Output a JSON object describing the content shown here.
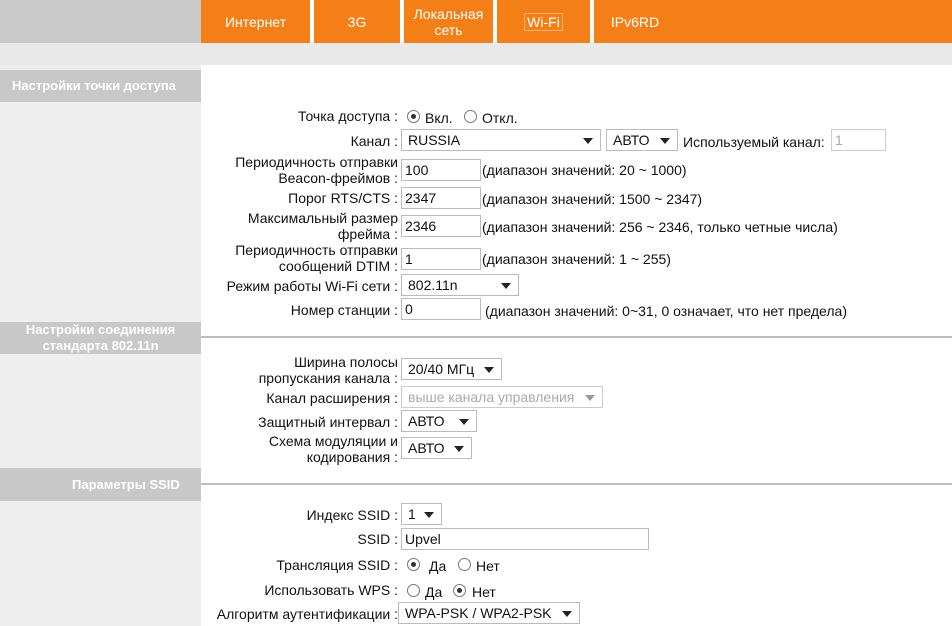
{
  "tabs": [
    "Интернет",
    "3G",
    "Локальная\nсеть",
    "Wi-Fi",
    "IPv6RD"
  ],
  "sections": {
    "ap": "Настройки точки доступа",
    "n": "Настройки соединения стандарта 802.11n",
    "ssid": "Параметры SSID"
  },
  "labels": {
    "ap": "Точка доступа :",
    "channel": "Канал :",
    "beacon": "Периодичность отправки Beacon-фреймов :",
    "rts": "Порог RTS/CTS :",
    "frag": "Максимальный размер фрейма :",
    "dtim": "Периодичность отправки сообщений DTIM :",
    "mode": "Режим работы Wi-Fi сети :",
    "station": "Номер станции :",
    "bw": "Ширина полосы пропускания канала :",
    "ext": "Канал расширения :",
    "guard": "Защитный интервал :",
    "mcs": "Схема модуляции и кодирования :",
    "ssid_idx": "Индекс SSID :",
    "ssid": "SSID :",
    "bcast": "Трансляция SSID :",
    "wps": "Использовать WPS :",
    "auth": "Алгоритм аутентификации :"
  },
  "values": {
    "on": "Вкл.",
    "off": "Откл.",
    "country": "RUSSIA",
    "channel": "АВТО",
    "used_ch_label": "Используемый канал:",
    "used_ch": "1",
    "beacon": "100",
    "beacon_hint": "(диапазон значений: 20 ~ 1000)",
    "rts": "2347",
    "rts_hint": "(диапазон значений: 1500 ~ 2347)",
    "frag": "2346",
    "frag_hint": "(диапазон значений: 256 ~ 2346, только четные числа)",
    "dtim": "1",
    "dtim_hint": "(диапазон значений: 1 ~ 255)",
    "mode": "802.11n",
    "station": "0",
    "station_hint": "(диапазон значений: 0~31, 0 означает, что нет предела)",
    "bw": "20/40 МГц",
    "ext": "выше канала управления",
    "guard": "АВТО",
    "mcs": "АВТО",
    "ssid_idx": "1",
    "ssid": "Upvel",
    "yes": "Да",
    "no": "Нет",
    "auth": "WPA-PSK / WPA2-PSK"
  }
}
